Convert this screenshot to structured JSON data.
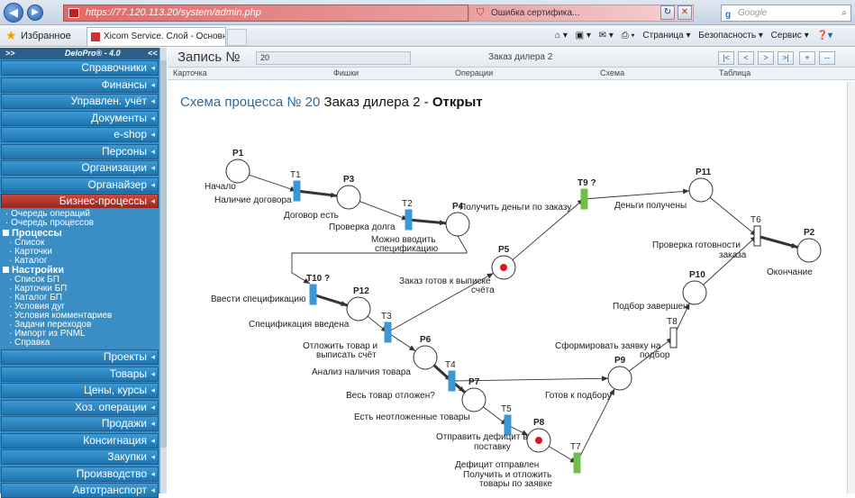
{
  "browser": {
    "url": "https://77.120.113.20/system/admin.php",
    "cert_error": "Ошибка сертифика...",
    "search_placeholder": "Google",
    "favorites": "Избранное",
    "tab_title": "Xicom Service. Слой - Основн...",
    "cmd_page": "Страница ▾",
    "cmd_security": "Безопасность ▾",
    "cmd_service": "Сервис ▾"
  },
  "sidebar": {
    "head_left": ">>",
    "app_name": "DeloPro® - 4.0",
    "head_right": "<<",
    "top_items": [
      "Справочники",
      "Финансы",
      "Управлен. учёт",
      "Документы",
      "e-shop",
      "Персоны",
      "Организации",
      "Органайзер"
    ],
    "active_item": "Бизнес-процессы",
    "sub": {
      "queue_ops": "Очередь операций",
      "queue_proc": "Очередь процессов",
      "processes": "Процессы",
      "proc_items": [
        "Список",
        "Карточки",
        "Каталог"
      ],
      "settings": "Настройки",
      "settings_items": [
        "Список БП",
        "Карточки БП",
        "Каталог БП",
        "Условия дуг",
        "Условия комментариев",
        "Задачи переходов",
        "Импорт из PNML",
        "Справка"
      ]
    },
    "bottom_items": [
      "Проекты",
      "Товары",
      "Цены, курсы",
      "Хоз. операции",
      "Продажи",
      "Консигнация",
      "Закупки",
      "Производство",
      "Автотранспорт"
    ]
  },
  "record": {
    "label": "Запись №",
    "number": "20",
    "title": "Заказ дилера 2",
    "pager": [
      "|<",
      "<",
      ">",
      ">|",
      "+",
      "--"
    ],
    "columns": [
      "Карточка",
      "Фишки",
      "Операции",
      "Схема",
      "Таблица"
    ]
  },
  "schema": {
    "prefix": "Схема процесса № 20",
    "name": "Заказ дилера 2",
    "dash": "-",
    "status": "Открыт"
  },
  "diagram": {
    "places": [
      "P1",
      "P3",
      "P4",
      "P5",
      "P6",
      "P7",
      "P8",
      "P9",
      "P10",
      "P11",
      "P12",
      "P2"
    ],
    "transitions": [
      "T1",
      "T2",
      "T3",
      "T4",
      "T5",
      "T6",
      "T7",
      "T8",
      "T9 ?",
      "T10 ?"
    ],
    "labels": [
      "Начало",
      "Наличие договора",
      "Договор есть",
      "Проверка долга",
      "Можно вводить",
      "спецификацию",
      "Получить деньги по заказу",
      "Деньги получены",
      "Проверка готовности",
      "заказа",
      "Окончание",
      "Заказ готов к выписке",
      "счёта",
      "Ввести спецификацию",
      "Спецификация введена",
      "Отложить товар и",
      "выписать счёт",
      "Анализ наличия товара",
      "Весь товар отложен?",
      "Есть неотложенные товары",
      "Отправить дефицит в",
      "поставку",
      "Дефицит отправлен",
      "Получить и отложить",
      "товары по заявке",
      "Готов к подбору",
      "Сформировать заявку на",
      "подбор",
      "Подбор завершен"
    ],
    "colors": {
      "blue": "#3d97d3",
      "green": "#6fc04a",
      "marker": "#e0141c"
    }
  }
}
